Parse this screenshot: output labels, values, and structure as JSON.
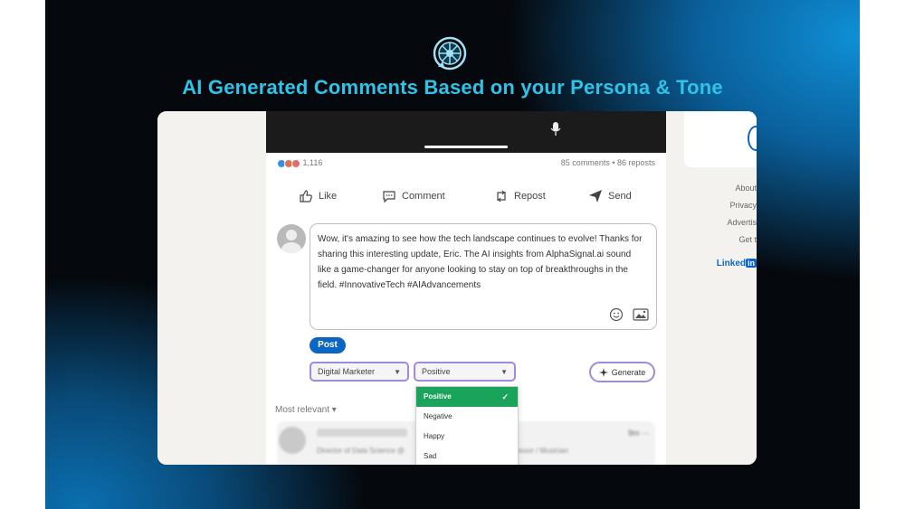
{
  "banner": {
    "headline": "AI Generated Comments Based on your Persona & Tone",
    "accent_color": "#2fc3e8",
    "logo_icon": "robot-aperture-logo-icon"
  },
  "post": {
    "reaction_count": "1,116",
    "comments_reposts": "85 comments • 86 reposts",
    "actions": [
      "Like",
      "Comment",
      "Repost",
      "Send"
    ]
  },
  "comment_box": {
    "text": "Wow, it's amazing to see how the tech landscape continues to evolve! Thanks for sharing this interesting update, Eric. The AI insights from AlphaSignal.ai sound like a game-changer for anyone looking to stay on top of breakthroughs in the field. #InnovativeTech #AIAdvancements",
    "post_label": "Post"
  },
  "controls": {
    "persona": "Digital Marketer",
    "tone": "Positive",
    "generate_label": "Generate"
  },
  "tone_options": [
    {
      "label": "Positive",
      "selected": true
    },
    {
      "label": "Negative",
      "selected": false
    },
    {
      "label": "Happy",
      "selected": false
    },
    {
      "label": "Sad",
      "selected": false
    }
  ],
  "feed": {
    "sort_label": "Most relevant ▾"
  },
  "next_comment": {
    "subtitle": "Director of Data Science @",
    "subtitle_right": "fessor / Musician",
    "time": "9m ···"
  },
  "right_panel": {
    "links": [
      "About",
      "Privacy",
      "Advertis",
      "Get t"
    ],
    "brand": "Linked",
    "brand_in": "in"
  }
}
